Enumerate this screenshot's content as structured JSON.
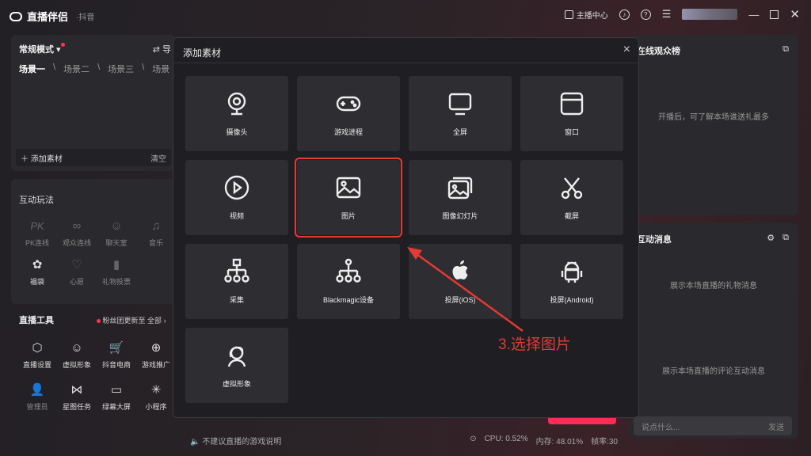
{
  "app": {
    "title": "直播伴侣",
    "platform": "·抖音",
    "anchor_center": "主播中心"
  },
  "left": {
    "mode": "常规模式",
    "guide": "导",
    "scenes": [
      "场景一",
      "场景二",
      "场景三",
      "场景"
    ],
    "add_material": "添加素材",
    "clear": "清空",
    "interact_title": "互动玩法",
    "interact_items": [
      {
        "label": "PK连线",
        "icon": "PK"
      },
      {
        "label": "观众连线",
        "icon": "∞"
      },
      {
        "label": "聊天室",
        "icon": "☺"
      },
      {
        "label": "音乐",
        "icon": "♫"
      },
      {
        "label": "福袋",
        "icon": "✿"
      },
      {
        "label": "心愿",
        "icon": "♡"
      },
      {
        "label": "礼物投票",
        "icon": "▮"
      }
    ],
    "tools_title": "直播工具",
    "fans_update": "粉丝团更新至",
    "all": "全部",
    "tools": [
      {
        "label": "直播设置",
        "icon": "⬡"
      },
      {
        "label": "虚拟形象",
        "icon": "☺"
      },
      {
        "label": "抖音电商",
        "icon": "🛒"
      },
      {
        "label": "游戏推广",
        "icon": "⊕"
      },
      {
        "label": "管理员",
        "icon": "👤"
      },
      {
        "label": "星图任务",
        "icon": "⋈"
      },
      {
        "label": "绿幕大屏",
        "icon": "▭"
      },
      {
        "label": "小程序",
        "icon": "✳"
      }
    ]
  },
  "right": {
    "audience_title": "在线观众榜",
    "audience_note": "开播后，可了解本场谁送礼最多",
    "messages_title": "互动消息",
    "gift_note": "展示本场直播的礼物消息",
    "comment_note": "展示本场直播的评论互动消息",
    "chat_placeholder": "说点什么...",
    "send": "发送"
  },
  "status": {
    "tip": "不建议直播的游戏说明",
    "cpu": "CPU: 0.52%",
    "mem": "内存: 48.01%",
    "fps": "帧率:30"
  },
  "modal": {
    "title": "添加素材",
    "close": "×",
    "tiles": [
      {
        "label": "摄像头",
        "icon": "camera"
      },
      {
        "label": "游戏进程",
        "icon": "gamepad"
      },
      {
        "label": "全屏",
        "icon": "monitor"
      },
      {
        "label": "窗口",
        "icon": "window"
      },
      {
        "label": "视频",
        "icon": "play"
      },
      {
        "label": "图片",
        "icon": "image"
      },
      {
        "label": "图像幻灯片",
        "icon": "slideshow"
      },
      {
        "label": "截屏",
        "icon": "scissors"
      },
      {
        "label": "采集",
        "icon": "capture"
      },
      {
        "label": "Blackmagic设备",
        "icon": "blackmagic"
      },
      {
        "label": "投屏(iOS)",
        "icon": "apple"
      },
      {
        "label": "投屏(Android)",
        "icon": "android"
      },
      {
        "label": "虚拟形象",
        "icon": "avatar"
      }
    ]
  },
  "annotation": "3.选择图片",
  "colors": {
    "accent": "#fe2c55",
    "highlight": "#e53935"
  }
}
